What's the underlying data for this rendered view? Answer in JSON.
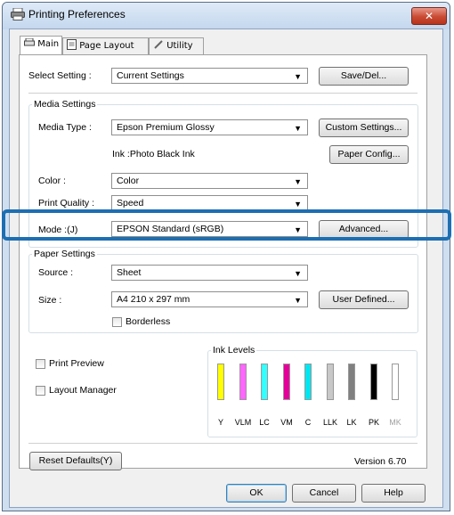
{
  "window": {
    "title": "Printing Preferences",
    "close_label": "✕"
  },
  "tabs": [
    {
      "label": "Main"
    },
    {
      "label": "Page Layout"
    },
    {
      "label": "Utility"
    }
  ],
  "select_setting": {
    "label": "Select Setting :",
    "value": "Current Settings",
    "save_button": "Save/Del..."
  },
  "media_settings": {
    "group_label": "Media Settings",
    "media_type": {
      "label": "Media Type :",
      "value": "Epson Premium Glossy"
    },
    "custom_settings_button": "Custom Settings...",
    "ink_info": "Ink :Photo Black Ink",
    "paper_config_button": "Paper Config...",
    "color": {
      "label": "Color :",
      "value": "Color"
    },
    "print_quality": {
      "label": "Print Quality :",
      "value": "Speed"
    },
    "mode": {
      "label": "Mode :(J)",
      "value": "EPSON Standard (sRGB)"
    },
    "advanced_button": "Advanced..."
  },
  "paper_settings": {
    "group_label": "Paper Settings",
    "source": {
      "label": "Source :",
      "value": "Sheet"
    },
    "size": {
      "label": "Size :",
      "value": "A4 210 x 297 mm"
    },
    "user_defined_button": "User Defined...",
    "borderless": {
      "label": "Borderless",
      "checked": false
    }
  },
  "print_preview": {
    "label": "Print Preview",
    "checked": false
  },
  "layout_manager": {
    "label": "Layout Manager",
    "checked": false
  },
  "ink_levels": {
    "group_label": "Ink Levels",
    "inks": [
      {
        "name": "Y",
        "color": "#ffff00"
      },
      {
        "name": "VLM",
        "color": "#ff66ff"
      },
      {
        "name": "LC",
        "color": "#33ffff"
      },
      {
        "name": "VM",
        "color": "#e6009a"
      },
      {
        "name": "C",
        "color": "#00e6f0"
      },
      {
        "name": "LLK",
        "color": "#c8c8c8"
      },
      {
        "name": "LK",
        "color": "#808080"
      },
      {
        "name": "PK",
        "color": "#000000"
      },
      {
        "name": "MK",
        "color": "#ffffff"
      }
    ]
  },
  "reset_defaults_button": "Reset Defaults(Y)",
  "version": "Version 6.70",
  "footer": {
    "ok": "OK",
    "cancel": "Cancel",
    "help": "Help"
  }
}
